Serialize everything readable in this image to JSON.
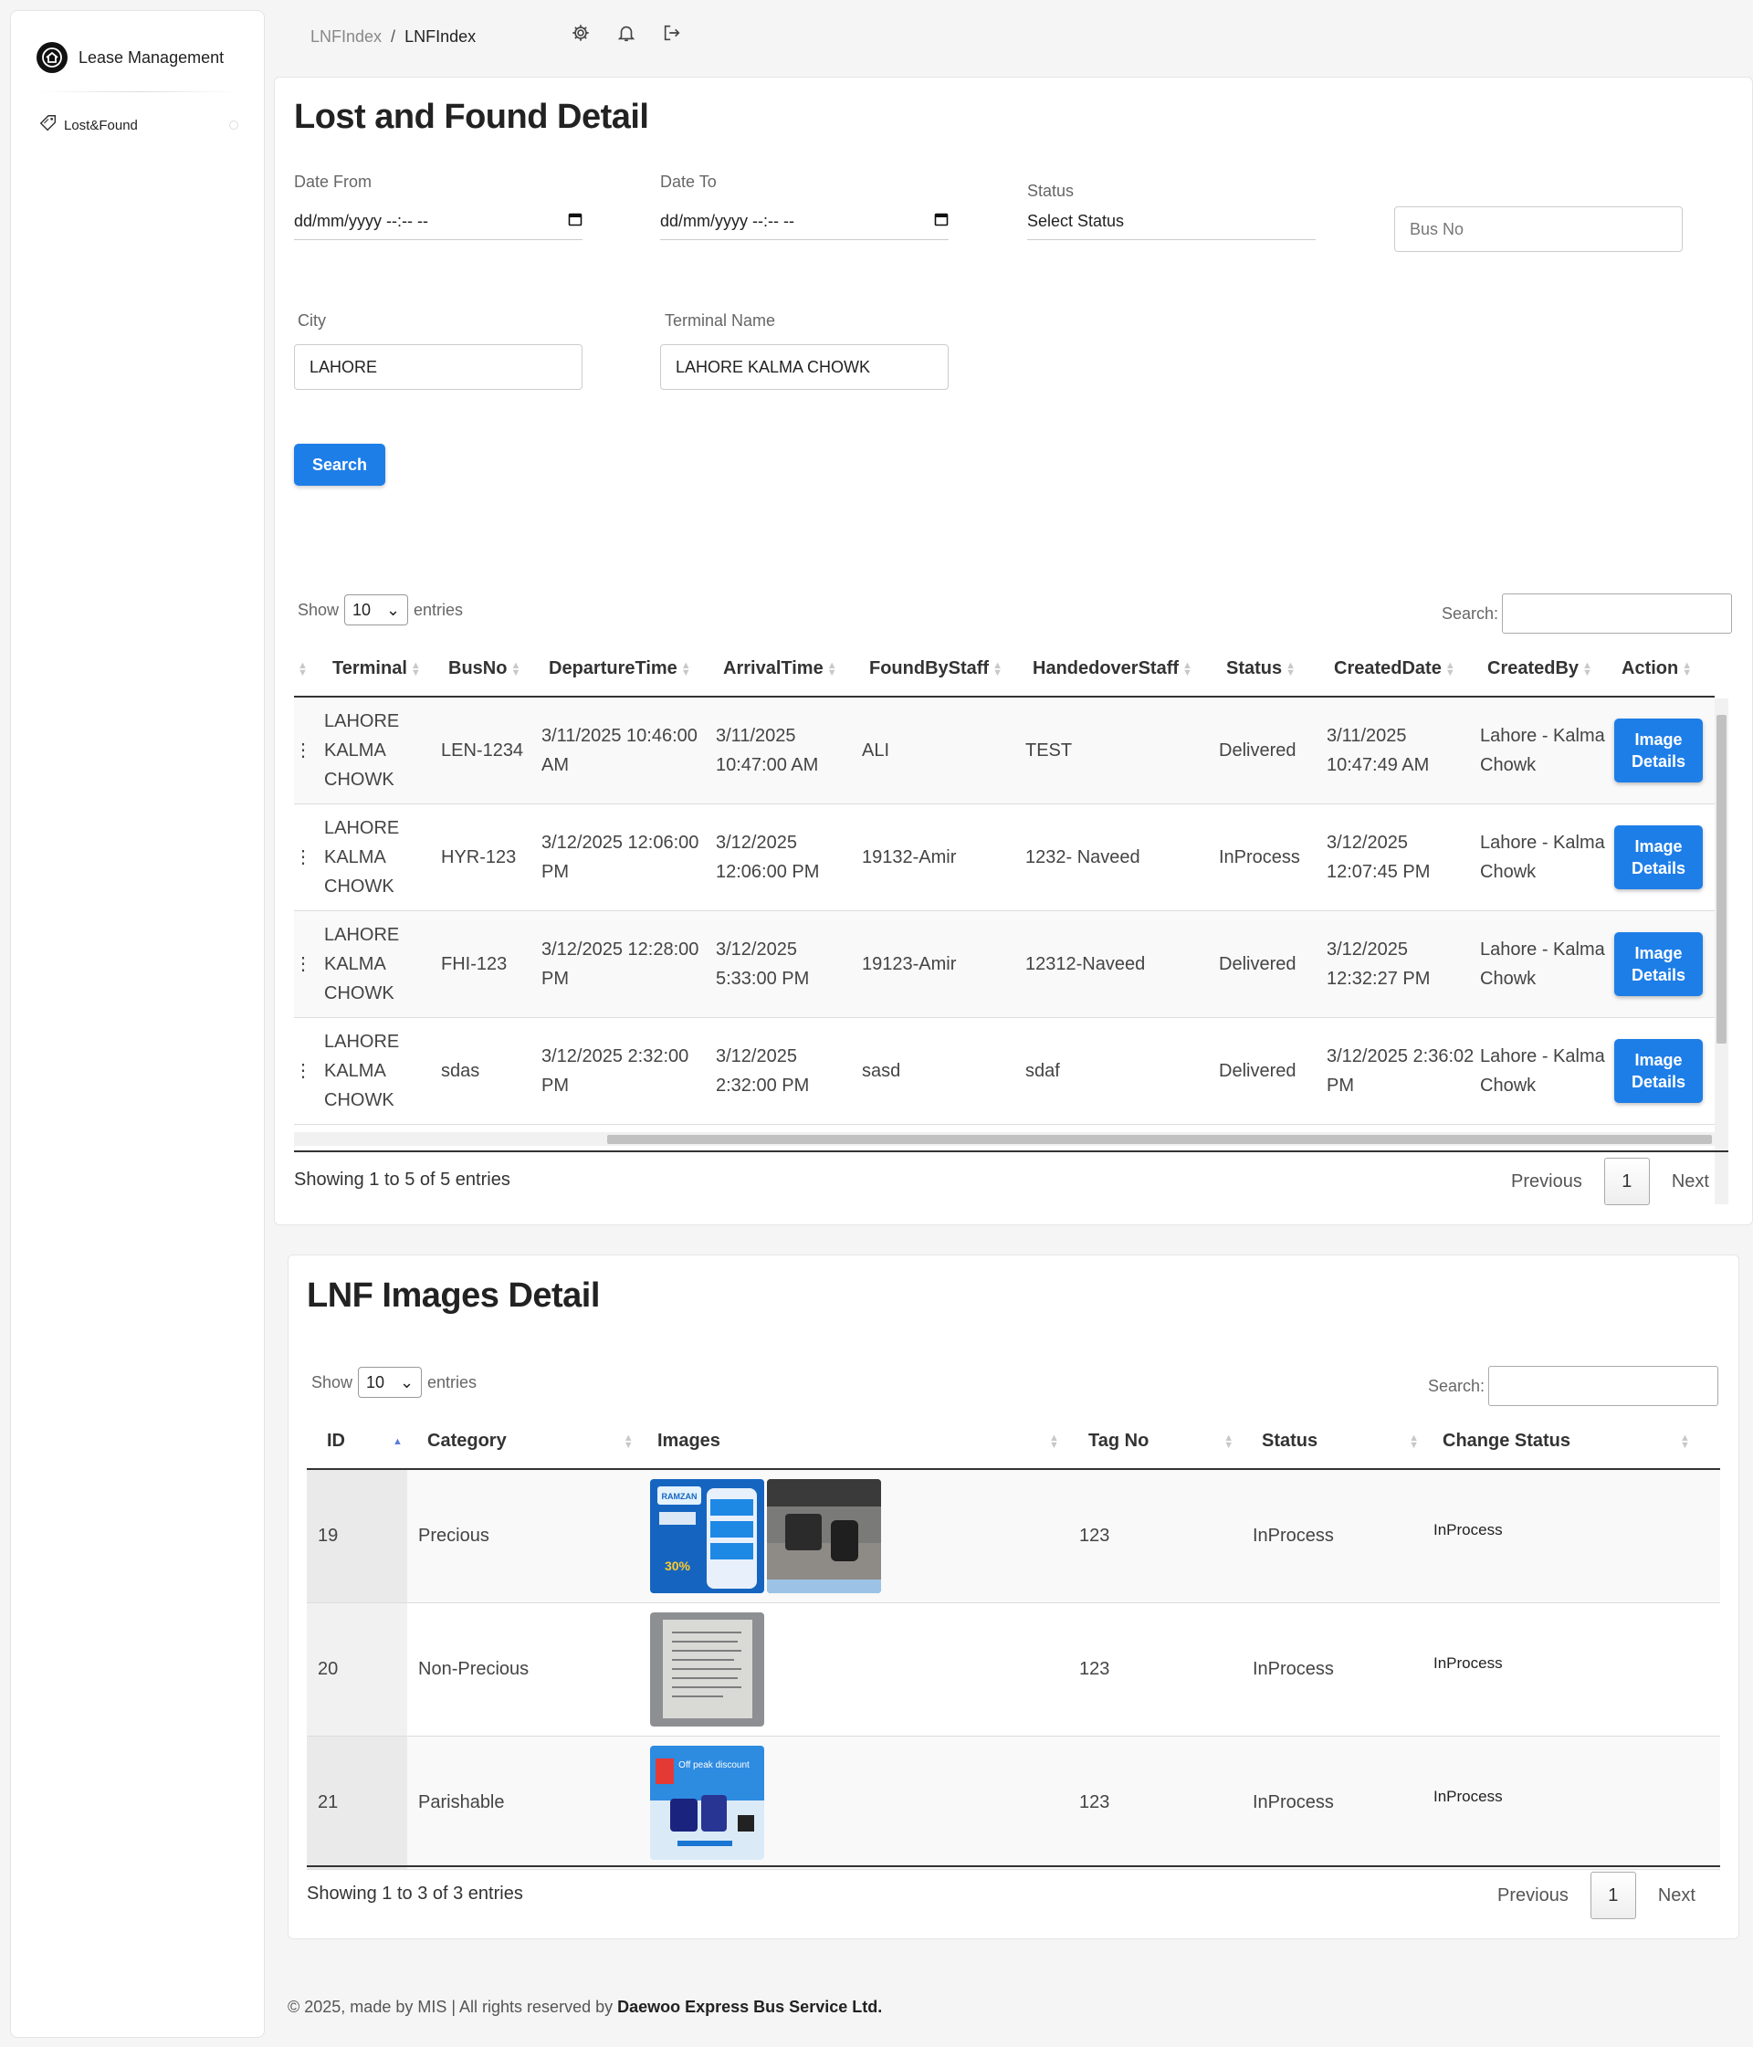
{
  "sidebar": {
    "brand": "Lease Management",
    "items": [
      {
        "label": "Lost&Found",
        "icon": "tag-icon"
      }
    ]
  },
  "breadcrumb": {
    "parent": "LNFIndex",
    "separator": "/",
    "current": "LNFIndex"
  },
  "topbar_icons": [
    "gear-icon",
    "bell-icon",
    "logout-icon"
  ],
  "lost_found": {
    "title": "Lost and Found Detail",
    "filters": {
      "date_from_label": "Date From",
      "date_from_value": "dd/mm/yyyy --:-- --",
      "date_to_label": "Date To",
      "date_to_value": "dd/mm/yyyy --:-- --",
      "status_label": "Status",
      "status_value": "Select Status",
      "bus_no_placeholder": "Bus No",
      "city_label": "City",
      "city_value": "LAHORE",
      "terminal_label": "Terminal Name",
      "terminal_value": "LAHORE KALMA CHOWK"
    },
    "search_button": "Search",
    "table": {
      "show_label": "Show",
      "page_length": "10",
      "entries_label": "entries",
      "search_label": "Search:",
      "columns": [
        "Terminal",
        "BusNo",
        "DepartureTime",
        "ArrivalTime",
        "FoundByStaff",
        "HandedoverStaff",
        "Status",
        "CreatedDate",
        "CreatedBy",
        "Action"
      ],
      "rows": [
        {
          "terminal": "LAHORE KALMA CHOWK",
          "bus": "LEN-1234",
          "departure": "3/11/2025 10:46:00 AM",
          "arrival": "3/11/2025 10:47:00 AM",
          "found_by": "ALI",
          "handed_over": "TEST",
          "status": "Delivered",
          "created_date": "3/11/2025 10:47:49 AM",
          "created_by": "Lahore - Kalma Chowk",
          "action": "Image Details"
        },
        {
          "terminal": "LAHORE KALMA CHOWK",
          "bus": "HYR-123",
          "departure": "3/12/2025 12:06:00 PM",
          "arrival": "3/12/2025 12:06:00 PM",
          "found_by": "19132-Amir",
          "handed_over": "1232- Naveed",
          "status": "InProcess",
          "created_date": "3/12/2025 12:07:45 PM",
          "created_by": "Lahore - Kalma Chowk",
          "action": "Image Details"
        },
        {
          "terminal": "LAHORE KALMA CHOWK",
          "bus": "FHI-123",
          "departure": "3/12/2025 12:28:00 PM",
          "arrival": "3/12/2025 5:33:00 PM",
          "found_by": "19123-Amir",
          "handed_over": "12312-Naveed",
          "status": "Delivered",
          "created_date": "3/12/2025 12:32:27 PM",
          "created_by": "Lahore - Kalma Chowk",
          "action": "Image Details"
        },
        {
          "terminal": "LAHORE KALMA CHOWK",
          "bus": "sdas",
          "departure": "3/12/2025 2:32:00 PM",
          "arrival": "3/12/2025 2:32:00 PM",
          "found_by": "sasd",
          "handed_over": "sdaf",
          "status": "Delivered",
          "created_date": "3/12/2025 2:36:02 PM",
          "created_by": "Lahore - Kalma Chowk",
          "action": "Image Details"
        }
      ],
      "info": "Showing 1 to 5 of 5 entries",
      "prev": "Previous",
      "page": "1",
      "next": "Next"
    }
  },
  "images_detail": {
    "title": "LNF Images Detail",
    "show_label": "Show",
    "page_length": "10",
    "entries_label": "entries",
    "search_label": "Search:",
    "columns": [
      "ID",
      "Category",
      "Images",
      "Tag No",
      "Status",
      "Change Status"
    ],
    "rows": [
      {
        "id": "19",
        "category": "Precious",
        "images": [
          "ramzan-package-ad-image",
          "bag-photo-image"
        ],
        "tag": "123",
        "status": "InProcess",
        "change_status": "InProcess"
      },
      {
        "id": "20",
        "category": "Non-Precious",
        "images": [
          "document-photo-image"
        ],
        "tag": "123",
        "status": "InProcess",
        "change_status": "InProcess"
      },
      {
        "id": "21",
        "category": "Parishable",
        "images": [
          "off-peak-discount-ad-image"
        ],
        "tag": "123",
        "status": "InProcess",
        "change_status": "InProcess"
      }
    ],
    "info": "Showing 1 to 3 of 3 entries",
    "prev": "Previous",
    "page": "1",
    "next": "Next"
  },
  "footer": {
    "text": "© 2025, made by MIS | All rights reserved by ",
    "company": "Daewoo Express Bus Service Ltd."
  },
  "colors": {
    "primary": "#1e7ee8",
    "background": "#f5f5f5"
  }
}
